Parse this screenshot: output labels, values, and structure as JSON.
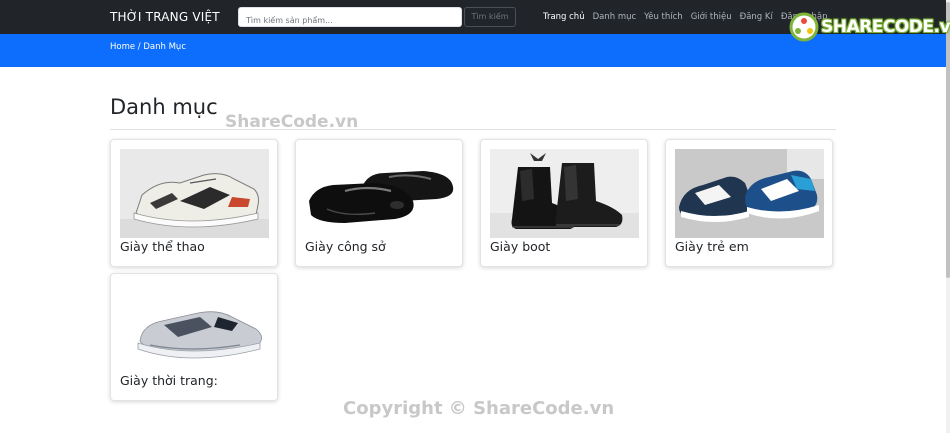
{
  "navbar": {
    "brand": "THỜI TRANG VIỆT",
    "search_placeholder": "Tìm kiếm sản phẩm...",
    "search_button": "Tìm kiếm",
    "links": [
      "Trang chủ",
      "Danh mục",
      "Yêu thích",
      "Giới thiệu",
      "Đăng Kí",
      "Đăng nhập"
    ],
    "active_link": "Trang chủ"
  },
  "breadcrumb": "Home / Danh Mục",
  "page_title": "Danh mục",
  "categories": [
    {
      "label": "Giày thể thao",
      "icon": "sneaker-image"
    },
    {
      "label": "Giày công sở",
      "icon": "dress-shoes-image"
    },
    {
      "label": "Giày boot",
      "icon": "boot-image"
    },
    {
      "label": "Giày trẻ em",
      "icon": "kids-shoe-image"
    },
    {
      "label": "Giày thời trang:",
      "icon": "fashion-shoe-image"
    }
  ],
  "watermark": {
    "logo_text": "SHARECODE.vn",
    "overlay_text": "ShareCode.vn",
    "copyright": "Copyright © ShareCode.vn"
  },
  "colors": {
    "navbar_bg": "#212529",
    "breadcrumb_bg": "#0d6efd",
    "logo_green": "#7fb43a"
  }
}
